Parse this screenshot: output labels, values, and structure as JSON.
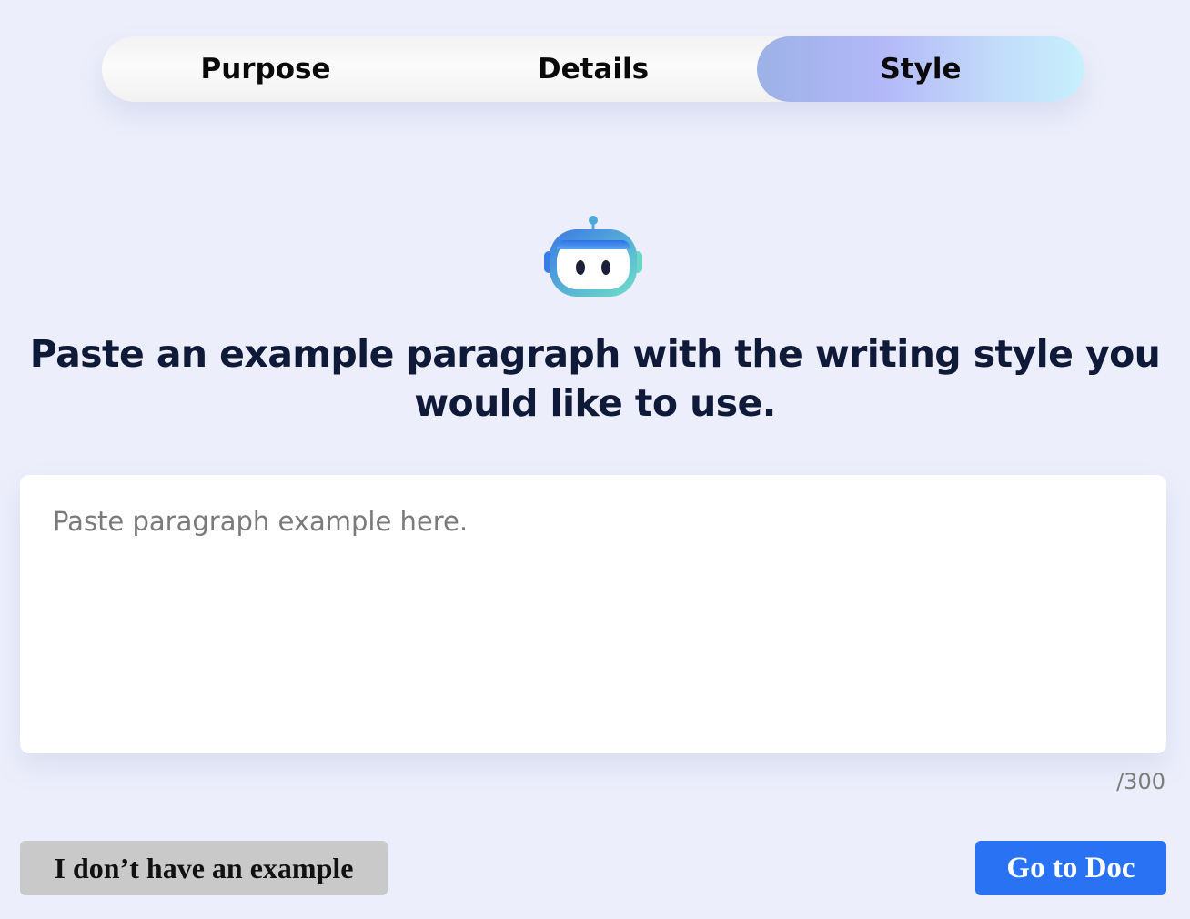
{
  "stepper": {
    "steps": [
      {
        "label": "Purpose",
        "active": false
      },
      {
        "label": "Details",
        "active": false
      },
      {
        "label": "Style",
        "active": true
      }
    ]
  },
  "robot": {
    "icon": "robot-icon"
  },
  "main": {
    "heading": "Paste an example paragraph with the writing style you would like to use.",
    "textarea": {
      "value": "",
      "placeholder": "Paste paragraph example here."
    },
    "counter": "/300"
  },
  "actions": {
    "no_example_label": "I don’t have an example",
    "go_to_doc_label": "Go to Doc"
  },
  "colors": {
    "background": "#eceefb",
    "heading": "#0e1a38",
    "primary": "#2872f3",
    "secondary": "#c9c9c9"
  }
}
